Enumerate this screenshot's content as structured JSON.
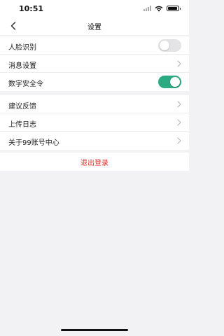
{
  "status_bar": {
    "time": "10:51"
  },
  "nav": {
    "title": "设置"
  },
  "group1": [
    {
      "label": "人脸识别",
      "control": "toggle",
      "on": false
    },
    {
      "label": "消息设置",
      "control": "chevron"
    },
    {
      "label": "数字安全令",
      "control": "toggle",
      "on": true
    }
  ],
  "group2": [
    {
      "label": "建议反馈",
      "control": "chevron"
    },
    {
      "label": "上传日志",
      "control": "chevron"
    },
    {
      "label": "关于99账号中心",
      "control": "chevron"
    }
  ],
  "logout": {
    "label": "退出登录",
    "color": "#e5302c"
  },
  "colors": {
    "toggle_on": "#2bab82",
    "toggle_off": "#e4e4e6",
    "background": "#f2f2f4"
  },
  "icons": {
    "back": "chevron-left-icon",
    "row_arrow": "chevron-right-icon"
  }
}
